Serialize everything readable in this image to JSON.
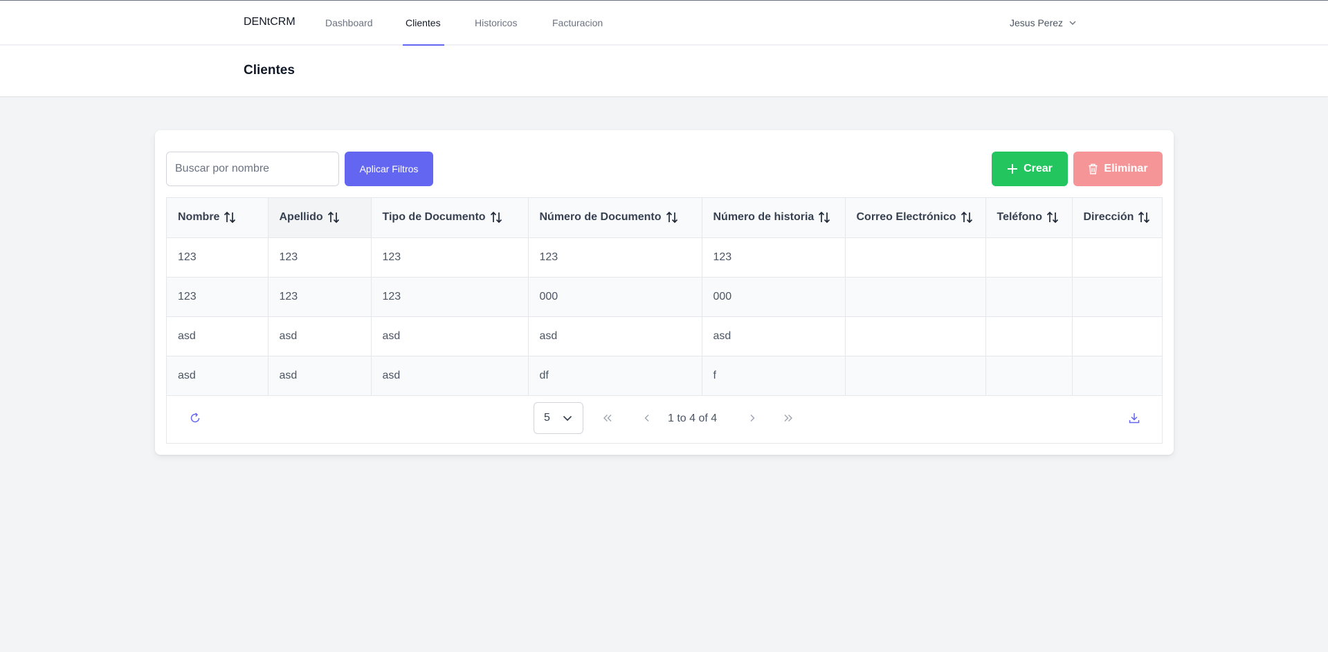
{
  "nav": {
    "brand": "DENtCRM",
    "links": [
      "Dashboard",
      "Clientes",
      "Historicos",
      "Facturacion"
    ],
    "active": "Clientes",
    "user": "Jesus Perez"
  },
  "page": {
    "title": "Clientes"
  },
  "toolbar": {
    "search_placeholder": "Buscar por nombre",
    "search_value": "",
    "filter_label": "Aplicar Filtros",
    "create_label": "Crear",
    "delete_label": "Eliminar"
  },
  "table": {
    "columns": [
      "Nombre",
      "Apellido",
      "Tipo de Documento",
      "Número de Documento",
      "Número de historia",
      "Correo Electrónico",
      "Teléfono",
      "Dirección"
    ],
    "rows": [
      [
        "123",
        "123",
        "123",
        "123",
        "123",
        "",
        "",
        ""
      ],
      [
        "123",
        "123",
        "123",
        "000",
        "000",
        "",
        "",
        ""
      ],
      [
        "asd",
        "asd",
        "asd",
        "asd",
        "asd",
        "",
        "",
        ""
      ],
      [
        "asd",
        "asd",
        "asd",
        "df",
        "f",
        "",
        "",
        ""
      ]
    ]
  },
  "paginator": {
    "rows_per_page": "5",
    "page_report": "1 to 4 of 4"
  },
  "colors": {
    "accent": "#6366f1",
    "create": "#22c55e",
    "delete": "#f69597"
  },
  "icons": [
    "chevron-down-icon",
    "plus-icon",
    "trash-icon",
    "sort-icon",
    "refresh-icon",
    "first-page-icon",
    "prev-page-icon",
    "next-page-icon",
    "last-page-icon",
    "download-icon"
  ]
}
